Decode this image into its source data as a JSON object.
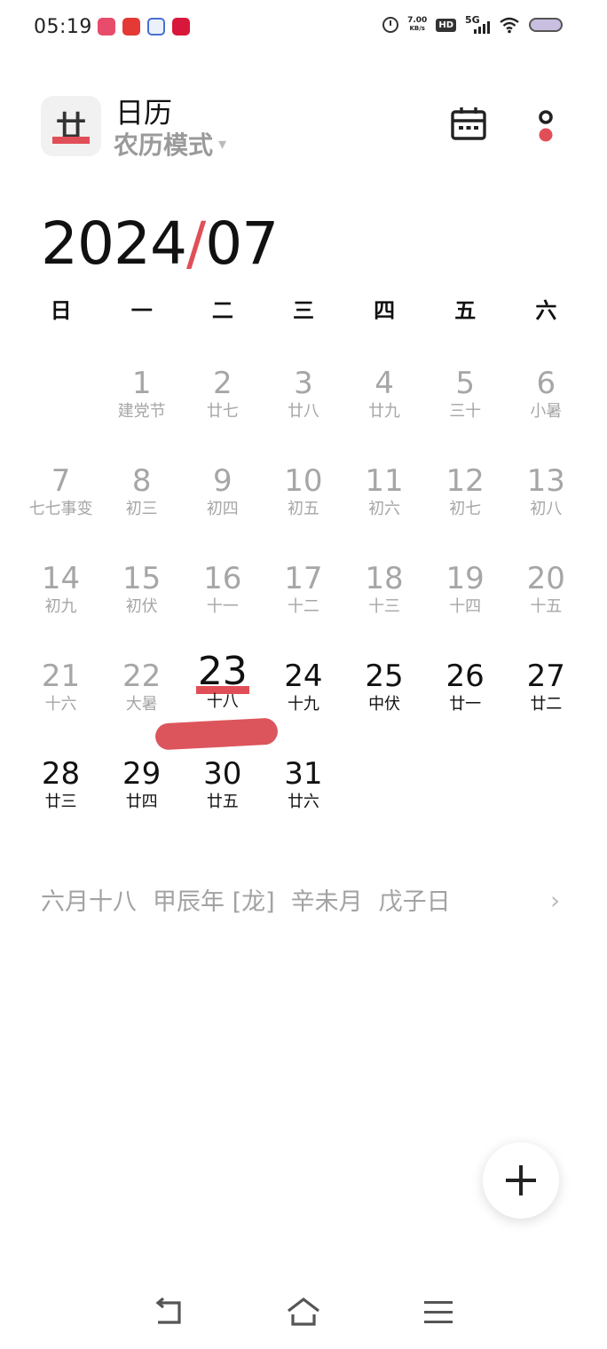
{
  "status_bar": {
    "time": "05:19",
    "speed_value": "7.00",
    "speed_unit": "KB/s",
    "hd": "HD",
    "network": "5G",
    "notification_icons": [
      "xiaohongshu-icon",
      "dianping-icon",
      "baidu-icon",
      "tmall-icon"
    ],
    "status_icons": [
      "alarm-icon",
      "hd-icon",
      "signal-5g-icon",
      "wifi-icon",
      "battery-icon"
    ]
  },
  "header": {
    "logo_char": "廿",
    "title": "日历",
    "mode": "农历模式",
    "mode_arrow": "▾",
    "icons": [
      "calendar-icon",
      "more-icon"
    ]
  },
  "month": {
    "year": "2024",
    "separator": "/",
    "month": "07"
  },
  "weekdays": [
    "日",
    "一",
    "二",
    "三",
    "四",
    "五",
    "六"
  ],
  "days": [
    {
      "day": "",
      "sub": ""
    },
    {
      "day": "1",
      "sub": "建党节"
    },
    {
      "day": "2",
      "sub": "廿七"
    },
    {
      "day": "3",
      "sub": "廿八"
    },
    {
      "day": "4",
      "sub": "廿九"
    },
    {
      "day": "5",
      "sub": "三十"
    },
    {
      "day": "6",
      "sub": "小暑"
    },
    {
      "day": "7",
      "sub": "七七事变"
    },
    {
      "day": "8",
      "sub": "初三"
    },
    {
      "day": "9",
      "sub": "初四"
    },
    {
      "day": "10",
      "sub": "初五"
    },
    {
      "day": "11",
      "sub": "初六"
    },
    {
      "day": "12",
      "sub": "初七"
    },
    {
      "day": "13",
      "sub": "初八"
    },
    {
      "day": "14",
      "sub": "初九"
    },
    {
      "day": "15",
      "sub": "初伏"
    },
    {
      "day": "16",
      "sub": "十一"
    },
    {
      "day": "17",
      "sub": "十二"
    },
    {
      "day": "18",
      "sub": "十三"
    },
    {
      "day": "19",
      "sub": "十四"
    },
    {
      "day": "20",
      "sub": "十五"
    },
    {
      "day": "21",
      "sub": "十六"
    },
    {
      "day": "22",
      "sub": "大暑"
    },
    {
      "day": "23",
      "sub": "十八"
    },
    {
      "day": "24",
      "sub": "十九"
    },
    {
      "day": "25",
      "sub": "中伏"
    },
    {
      "day": "26",
      "sub": "廿一"
    },
    {
      "day": "27",
      "sub": "廿二"
    },
    {
      "day": "28",
      "sub": "廿三"
    },
    {
      "day": "29",
      "sub": "廿四"
    },
    {
      "day": "30",
      "sub": "廿五"
    },
    {
      "day": "31",
      "sub": "廿六"
    }
  ],
  "today": "23",
  "accent_color": "#e04f57",
  "lunar_info": {
    "date": "六月十八",
    "year": "甲辰年 [龙]",
    "month": "辛未月",
    "day": "戊子日",
    "chevron": "›"
  },
  "fab": {
    "icon": "plus-icon"
  },
  "nav": {
    "icons": [
      "back-icon",
      "home-icon",
      "menu-icon"
    ]
  }
}
